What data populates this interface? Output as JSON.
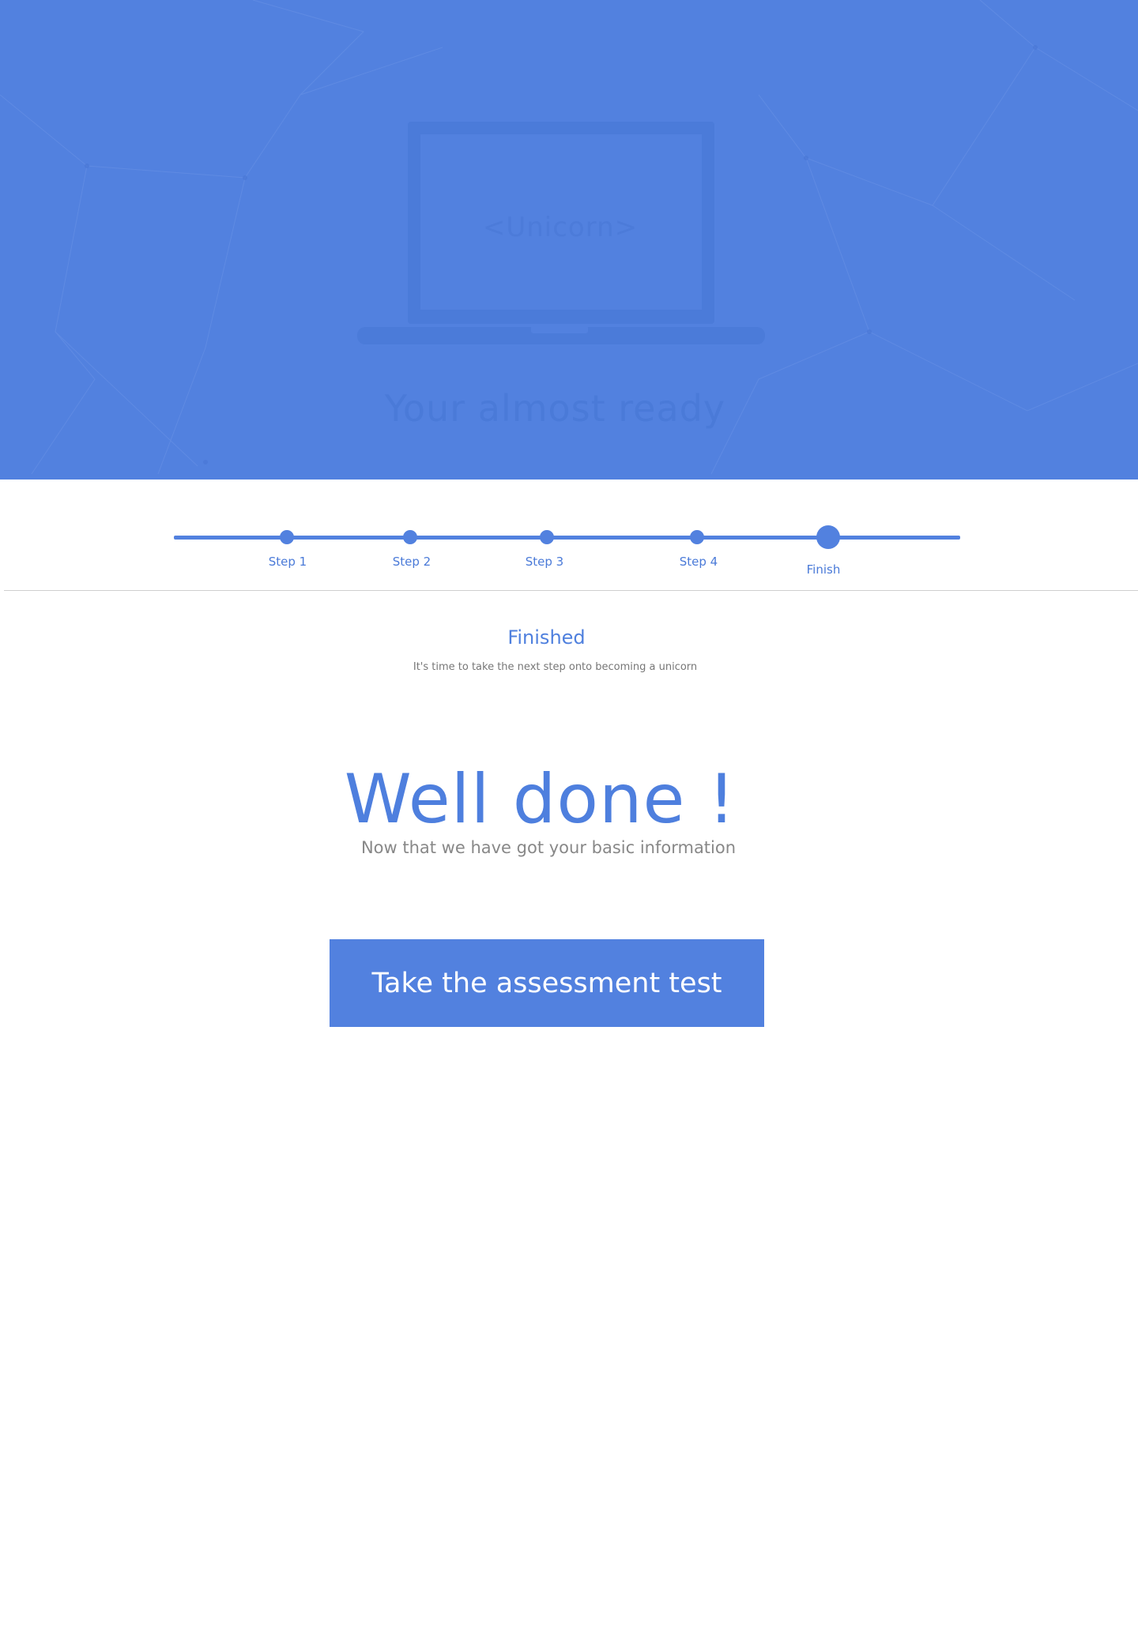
{
  "hero": {
    "laptop_text": "<Unicorn>",
    "title": "Your almost ready"
  },
  "stepper": {
    "steps": [
      {
        "label": "Step 1"
      },
      {
        "label": "Step 2"
      },
      {
        "label": "Step 3"
      },
      {
        "label": "Step 4"
      },
      {
        "label": "Finish"
      }
    ],
    "current": "Finish"
  },
  "section": {
    "title": "Finished",
    "subtitle": "It's time to take the next step onto becoming a unicorn"
  },
  "main": {
    "heading": "Well done !",
    "subheading": "Now that we have got your basic information",
    "cta_label": "Take the assessment test"
  },
  "colors": {
    "accent": "#5281df",
    "muted_text": "#888888",
    "divider": "#cfcfcf"
  }
}
